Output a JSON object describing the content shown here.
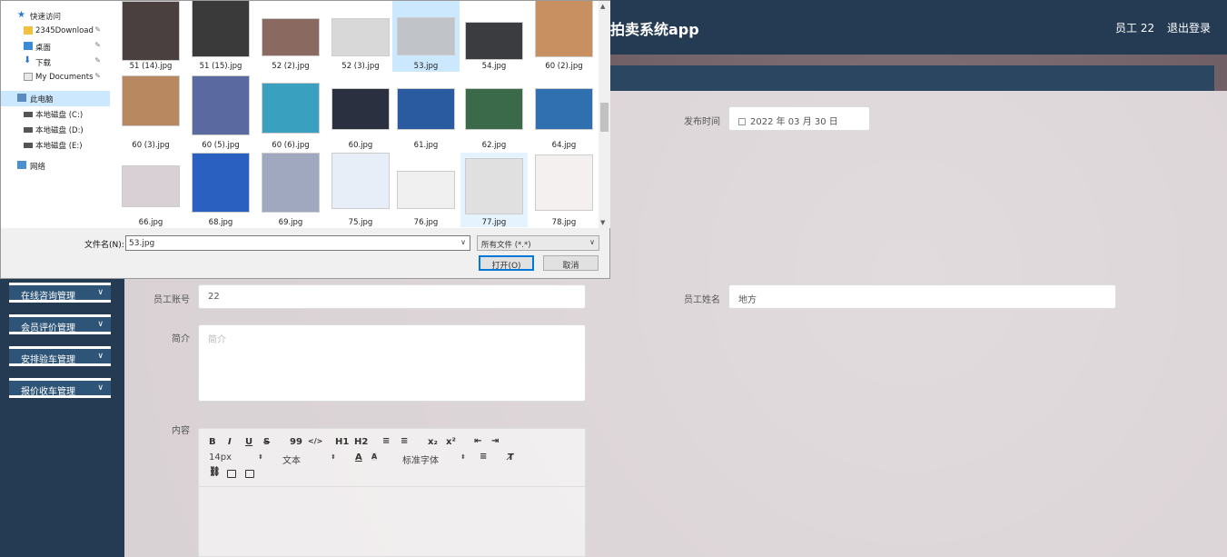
{
  "app": {
    "title": "拍卖系统app",
    "user": "员工 22",
    "logout": "退出登录"
  },
  "sidebar": {
    "items": [
      {
        "label": "在线咨询管理"
      },
      {
        "label": "会员评价管理"
      },
      {
        "label": "安排验车管理"
      },
      {
        "label": "报价收车管理"
      }
    ]
  },
  "form": {
    "publish_time_label": "发布时间",
    "publish_time_value": "2022 年 03 月 30 日",
    "account_label": "员工账号",
    "account_value": "22",
    "name_label": "员工姓名",
    "name_value": "地方",
    "intro_label": "简介",
    "intro_placeholder": "简介",
    "content_label": "内容"
  },
  "editor": {
    "font_size": "14px",
    "text_type": "文本",
    "font_family": "标准字体",
    "buttons": [
      "B",
      "I",
      "U",
      "S",
      "99",
      "</>",
      "H1",
      "H2",
      "≡",
      "≡",
      "x₂",
      "x²",
      "⇤",
      "⇥"
    ]
  },
  "dialog": {
    "nav": {
      "quick_access": "快速访问",
      "download_folder": "2345Download",
      "desktop": "桌面",
      "downloads": "下载",
      "documents": "My Documents",
      "this_pc": "此电脑",
      "drive_c": "本地磁盘 (C:)",
      "drive_d": "本地磁盘 (D:)",
      "drive_e": "本地磁盘 (E:)",
      "network": "网络"
    },
    "files": [
      {
        "name": "51 (14).jpg",
        "color": "#4a4040"
      },
      {
        "name": "51 (15).jpg",
        "color": "#3a3a3a"
      },
      {
        "name": "52 (2).jpg",
        "color": "#8a6a60"
      },
      {
        "name": "52 (3).jpg",
        "color": "#d8d8d8"
      },
      {
        "name": "53.jpg",
        "color": "#c0c4c8"
      },
      {
        "name": "54.jpg",
        "color": "#3a3c40"
      },
      {
        "name": "60 (2).jpg",
        "color": "#c89060"
      },
      {
        "name": "60 (3).jpg",
        "color": "#b88860"
      },
      {
        "name": "60 (5).jpg",
        "color": "#5a6aa0"
      },
      {
        "name": "60 (6).jpg",
        "color": "#3aa0c0"
      },
      {
        "name": "60.jpg",
        "color": "#2a3040"
      },
      {
        "name": "61.jpg",
        "color": "#2a5aa0"
      },
      {
        "name": "62.jpg",
        "color": "#3a6a4a"
      },
      {
        "name": "64.jpg",
        "color": "#3070b0"
      },
      {
        "name": "66.jpg",
        "color": "#d8d0d4"
      },
      {
        "name": "68.jpg",
        "color": "#2a60c0"
      },
      {
        "name": "69.jpg",
        "color": "#a0a8c0"
      },
      {
        "name": "75.jpg",
        "color": "#e8eef8"
      },
      {
        "name": "76.jpg",
        "color": "#f0f0f0"
      },
      {
        "name": "77.jpg",
        "color": "#e0e0e0"
      },
      {
        "name": "78.jpg",
        "color": "#f4f0f0"
      }
    ],
    "filename_label": "文件名(N):",
    "filename_value": "53.jpg",
    "filter": "所有文件 (*.*)",
    "open_button": "打开(O)",
    "cancel_button": "取消"
  }
}
